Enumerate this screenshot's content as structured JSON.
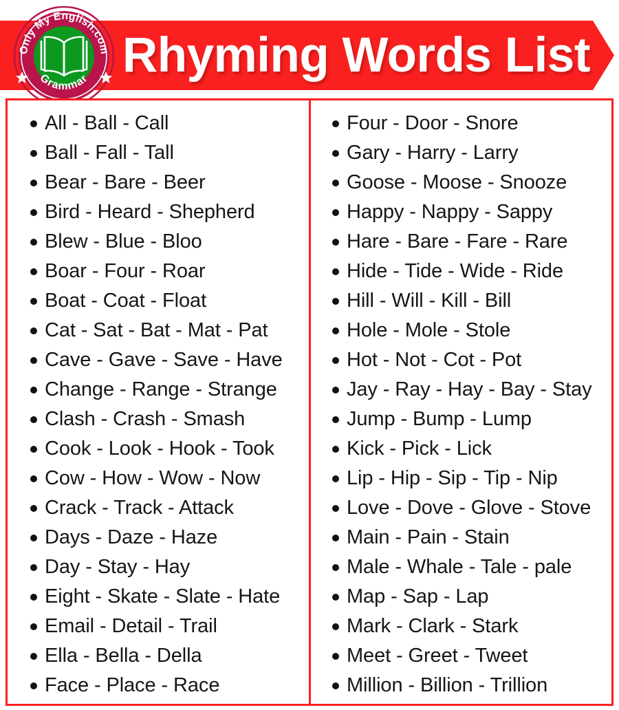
{
  "header": {
    "title": "Rhyming Words List",
    "banner_color": "#fa2020",
    "title_color": "#ffffff",
    "logo": {
      "top_text": "Only My English.com",
      "bottom_text": "Grammar",
      "ring_color": "#b9154a",
      "center_color": "#0c9920",
      "icon": "open-book-icon",
      "star_left": "★",
      "star_right": "★"
    }
  },
  "content": {
    "border_color": "#fa2020",
    "divider_color": "#fa2020",
    "text_color": "#161616",
    "bullet_color": "#111111",
    "columns": [
      {
        "items": [
          "All - Ball - Call",
          "Ball - Fall - Tall",
          "Bear - Bare - Beer",
          "Bird - Heard - Shepherd",
          "Blew - Blue - Bloo",
          "Boar - Four - Roar",
          "Boat - Coat - Float",
          "Cat - Sat - Bat - Mat - Pat",
          "Cave - Gave - Save - Have",
          "Change - Range - Strange",
          "Clash - Crash - Smash",
          "Cook - Look - Hook - Took",
          "Cow - How - Wow - Now",
          "Crack - Track - Attack",
          "Days - Daze - Haze",
          "Day - Stay - Hay",
          "Eight - Skate - Slate - Hate",
          "Email - Detail - Trail",
          "Ella - Bella - Della",
          "Face - Place - Race"
        ]
      },
      {
        "items": [
          "Four - Door - Snore",
          "Gary - Harry - Larry",
          "Goose - Moose - Snooze",
          "Happy - Nappy - Sappy",
          "Hare - Bare - Fare - Rare",
          "Hide - Tide - Wide - Ride",
          "Hill - Will - Kill - Bill",
          "Hole - Mole - Stole",
          "Hot - Not - Cot - Pot",
          "Jay - Ray - Hay - Bay - Stay",
          "Jump - Bump - Lump",
          "Kick - Pick - Lick",
          "Lip - Hip - Sip - Tip - Nip",
          "Love - Dove - Glove - Stove",
          "Main - Pain - Stain",
          "Male - Whale - Tale - pale",
          "Map - Sap - Lap",
          "Mark - Clark - Stark",
          "Meet - Greet - Tweet",
          "Million - Billion - Trillion"
        ]
      }
    ]
  }
}
